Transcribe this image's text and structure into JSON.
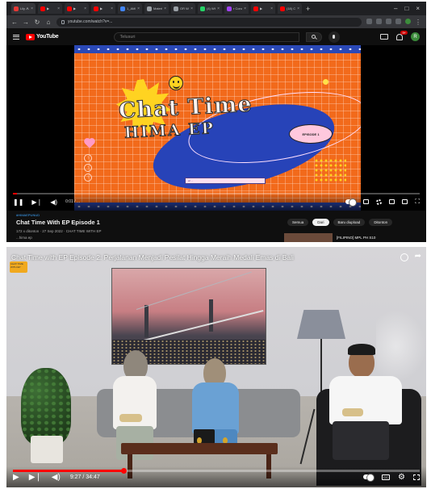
{
  "browser": {
    "tabs": [
      {
        "title": "Lily ᗑᗑᗑ",
        "color": "#e53935"
      },
      {
        "title": "▶",
        "color": "#ff0000"
      },
      {
        "title": "▶",
        "color": "#ff0000"
      },
      {
        "title": "▶",
        "color": "#ff0000"
      },
      {
        "title": "1_AMD M",
        "color": "#4285f4"
      },
      {
        "title": "Materi Gu",
        "color": "#9aa0a6"
      },
      {
        "title": "OR W Ari",
        "color": "#9aa0a6"
      },
      {
        "title": "(4) WhatsA",
        "color": "#25d366"
      },
      {
        "title": "r Conoid C",
        "color": "#a142f4"
      },
      {
        "title": "▶",
        "color": "#ff0000"
      },
      {
        "title": "(18) Ch",
        "color": "#ff0000"
      }
    ],
    "url": "youtube.com/watch?v=..."
  },
  "youtube": {
    "logo": "YouTube",
    "search_placeholder": "Telusuri",
    "notification_count": "9+",
    "avatar_letter": "R"
  },
  "thumbnail": {
    "title_line1": "Chat Time",
    "title_line2": "HIMA EP",
    "episode_pill": "EPISODE 1",
    "footer_text": "w/ ..."
  },
  "player_top": {
    "time": "0:01 / ...",
    "progress": 0.01
  },
  "video_info": {
    "hashtag": "#HIMAEPUNUD",
    "title": "Chat Time With EP Episode 1",
    "meta": "172 x ditonton · 27 Sep 2022 · CHAT TIME WITH EP",
    "channel": "...hima ep",
    "chips": [
      "Semua",
      "Dari",
      "Baru diupload",
      "Ditonton"
    ],
    "selected_chip": 1,
    "recommended_title": "[FILIPINO] MPL PH S10"
  },
  "player_bottom": {
    "title": "Chat Time with EP Episode 2: Perjalanan Menjadi Pesilat Hingga Meraih Medali Emas di Bali",
    "logo_text": "CHAT TIME WITH EP",
    "time": "9:27 / 34:47",
    "progress": 0.272
  }
}
